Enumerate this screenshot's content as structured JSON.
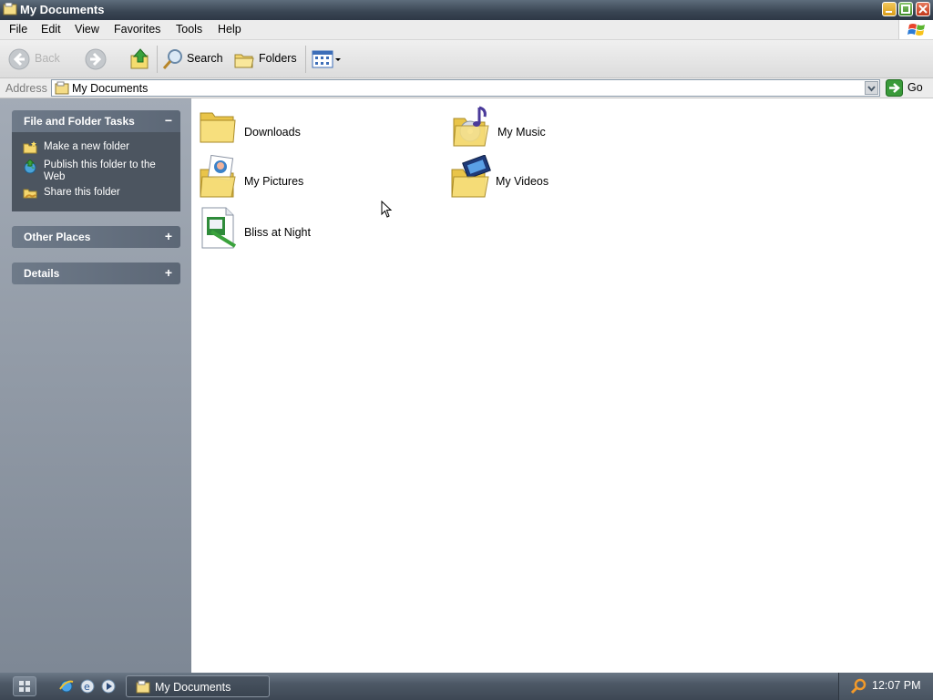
{
  "window": {
    "title": "My Documents",
    "controls": [
      "minimize",
      "maximize",
      "close"
    ]
  },
  "menu": [
    "File",
    "Edit",
    "View",
    "Favorites",
    "Tools",
    "Help"
  ],
  "toolbar": {
    "back_label": "Back",
    "search_label": "Search",
    "folders_label": "Folders"
  },
  "address": {
    "label": "Address",
    "value": "My Documents",
    "go_label": "Go"
  },
  "left_pane": {
    "file_tasks": {
      "title": "File and Folder Tasks",
      "toggle": "−",
      "items": [
        {
          "label": "Make a new folder",
          "icon": "new-folder-icon"
        },
        {
          "label": "Publish this folder to the Web",
          "icon": "publish-web-icon"
        },
        {
          "label": "Share this folder",
          "icon": "share-folder-icon"
        }
      ]
    },
    "other_places": {
      "title": "Other Places",
      "toggle": "+"
    },
    "details": {
      "title": "Details",
      "toggle": "+"
    }
  },
  "content": {
    "items": [
      {
        "label": "Downloads",
        "icon": "folder-icon"
      },
      {
        "label": "My Music",
        "icon": "music-folder-icon"
      },
      {
        "label": "My Pictures",
        "icon": "pictures-folder-icon"
      },
      {
        "label": "My Videos",
        "icon": "videos-folder-icon"
      },
      {
        "label": "Bliss at Night",
        "icon": "document-icon"
      }
    ]
  },
  "taskbar": {
    "task_button": "My Documents",
    "clock": "12:07 PM"
  },
  "colors": {
    "titlebar": "#394553",
    "left_pane": "#8e97a3",
    "panel_body": "#4c5560",
    "taskbar": "#4d5866",
    "folder_yellow": "#f5d76e"
  }
}
